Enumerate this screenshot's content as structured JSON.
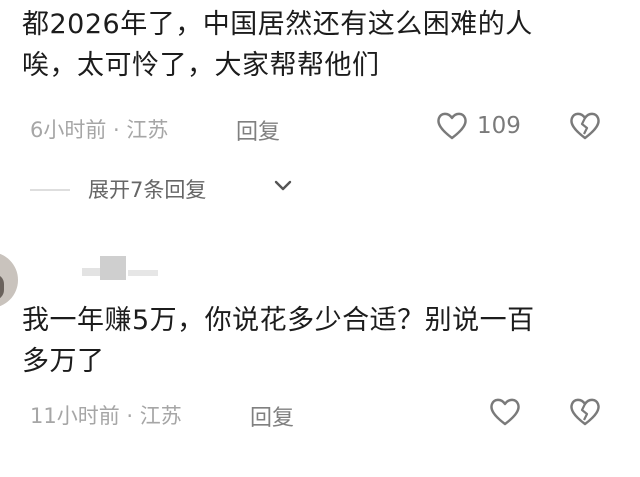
{
  "comments": [
    {
      "text_line1": "都2026年了，中国居然还有这么困难的人",
      "text_line2": "唉，太可怜了，大家帮帮他们",
      "meta": "6小时前 · 江苏",
      "reply_label": "回复",
      "like_count": "109"
    },
    {
      "text_line1": "我一年赚5万，你说花多少合适？别说一百",
      "text_line2": "多万了",
      "meta": "11小时前 · 江苏",
      "reply_label": "回复"
    }
  ],
  "expand_replies": {
    "label": "展开7条回复"
  },
  "colors": {
    "text": "#1c1c1c",
    "meta": "#a6a6a6",
    "icon": "#7a7a7a",
    "divider": "#dedede"
  },
  "icons": [
    "heart-icon",
    "broken-heart-icon",
    "chevron-down-icon"
  ]
}
